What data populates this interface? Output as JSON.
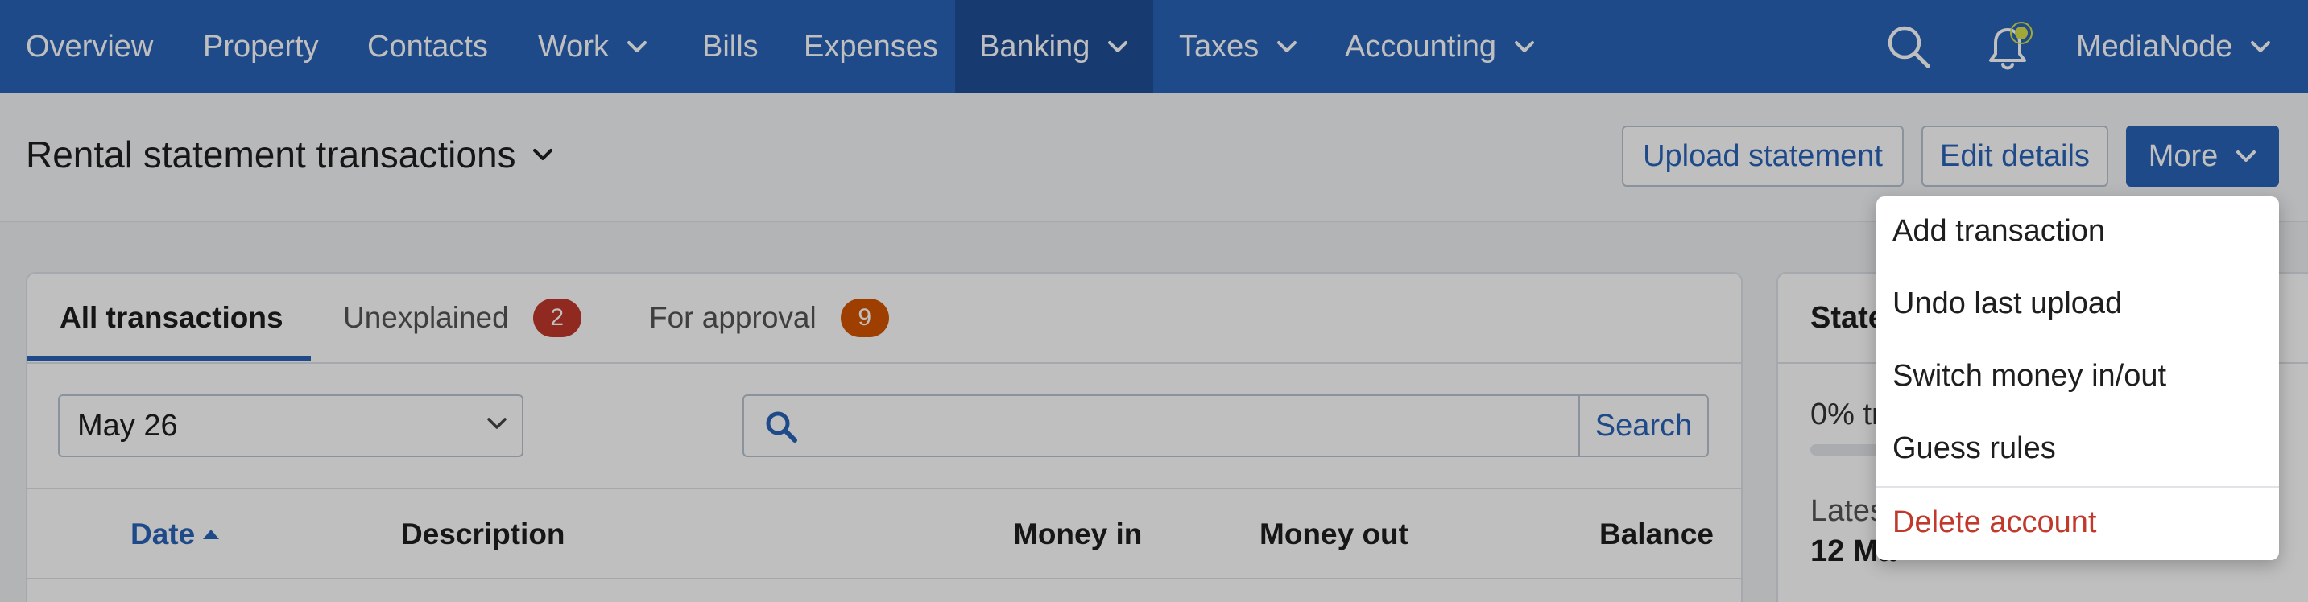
{
  "nav": {
    "items": [
      "Overview",
      "Property",
      "Contacts",
      "Work",
      "Bills",
      "Expenses",
      "Banking",
      "Taxes",
      "Accounting"
    ],
    "active": "Banking",
    "user": "MediaNode",
    "icons": [
      "search-icon",
      "bell-icon",
      "chevron-down-icon"
    ]
  },
  "header": {
    "title": "Rental statement transactions",
    "buttons": {
      "upload": "Upload statement",
      "edit": "Edit details",
      "more": "More"
    }
  },
  "tabs": [
    {
      "label": "All transactions"
    },
    {
      "label": "Unexplained",
      "count": "2",
      "color": "#c0392b"
    },
    {
      "label": "For approval",
      "count": "9",
      "color": "#d35400"
    }
  ],
  "filters": {
    "month": "May 26",
    "search_value": "",
    "search_button": "Search"
  },
  "table": {
    "columns": [
      "Date",
      "Description",
      "Money in",
      "Money out",
      "Balance"
    ],
    "sort": "Date ascending"
  },
  "statement_panel": {
    "heading_partial": "State",
    "progress_partial": "0% tr",
    "latest_label_partial": "Lates",
    "latest_value_partial": "12 Ma"
  },
  "more_menu": {
    "items": [
      "Add transaction",
      "Undo last upload",
      "Switch money in/out",
      "Guess rules"
    ],
    "danger_item": "Delete account",
    "hovered": "Undo last upload"
  },
  "colors": {
    "nav_bg": "#2a63b9",
    "nav_active": "#1f4e96",
    "accent": "#2a63b9",
    "danger": "#c0392b",
    "bell_dot": "#d9e04a"
  }
}
